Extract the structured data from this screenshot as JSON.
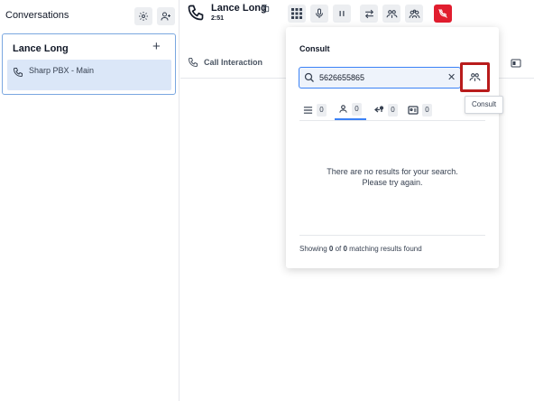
{
  "conversations": {
    "title": "Conversations",
    "settings_icon": "gear-icon",
    "add_user_icon": "add-user-icon",
    "card": {
      "name": "Lance Long",
      "add_label": "+",
      "line_label": "Sharp PBX - Main"
    }
  },
  "call": {
    "caller_name": "Lance Long",
    "duration": "2:51",
    "controls": [
      "dialpad-icon",
      "microphone-icon",
      "pause-icon",
      "transfer-icon",
      "consult-icon",
      "conference-icon",
      "hangup-icon"
    ],
    "hangup_color": "#e11d2e"
  },
  "main": {
    "interaction_label": "Call Interaction"
  },
  "consult_popover": {
    "title": "Consult",
    "search_value": "5626655865",
    "clear_label": "✕",
    "consult_button_highlight": "#b91c1c",
    "tabs": [
      {
        "icon": "list-icon",
        "count": "0"
      },
      {
        "icon": "person-icon",
        "count": "0"
      },
      {
        "icon": "queue-icon",
        "count": "0"
      },
      {
        "icon": "contact-card-icon",
        "count": "0"
      }
    ],
    "empty_line1": "There are no results for your search.",
    "empty_line2": "Please try again.",
    "footer": {
      "prefix": "Showing ",
      "shown": "0",
      "middle": " of ",
      "total": "0",
      "suffix": " matching results found"
    }
  },
  "tooltip": "Consult",
  "accent_color": "#3b82f6"
}
